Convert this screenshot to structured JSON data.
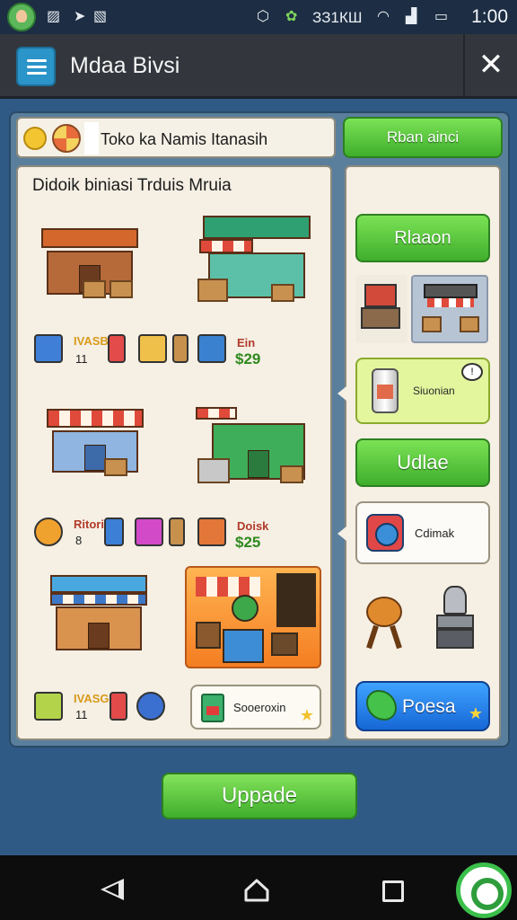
{
  "status_bar": {
    "clock_mid": "ЗЗ1КШ",
    "time": "1:00"
  },
  "title_bar": {
    "title": "Mdaa Bivsi",
    "close_glyph": "✕"
  },
  "name_box": {
    "text": "Toko ka Namis Itanasih"
  },
  "top_button": {
    "label": "Rban ainci"
  },
  "left_panel": {
    "heading": "Didoik biniasi Trduis Mruia",
    "row1": {
      "label": "IVASBH",
      "num": "11",
      "price_label": "Ein",
      "price": "$29"
    },
    "row2": {
      "label": "Ritori",
      "num": "8",
      "price_label": "Doisk",
      "price": "$25"
    },
    "row3": {
      "label": "IVASGH",
      "num": "11"
    },
    "note_card": {
      "text": "Sooeroxin"
    }
  },
  "right_panel": {
    "btn1": "Rlaaon",
    "lime_card": {
      "text": "Siuonian"
    },
    "btn2": "Udlae",
    "white_card": {
      "text": "Cdimak"
    },
    "blue_button": "Poesa"
  },
  "upgrade_button": "Uppade",
  "icons": {
    "menu": "menu-icon",
    "close": "close-icon",
    "coin": "coin-icon",
    "store": "store-icon",
    "back": "nav-back-icon",
    "home": "nav-home-icon",
    "recent": "nav-recent-icon"
  },
  "colors": {
    "accent_green": "#3fae2c",
    "accent_blue": "#1667d6",
    "title_bar": "#33373d",
    "background": "#2f5a86"
  }
}
